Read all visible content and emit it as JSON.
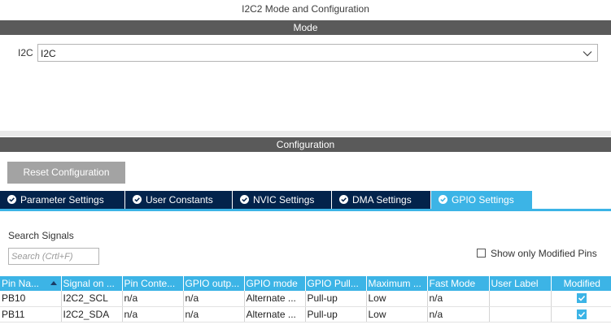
{
  "title": "I2C2 Mode and Configuration",
  "mode_section": {
    "header": "Mode",
    "field_label": "I2C",
    "selected_value": "I2C"
  },
  "config_section": {
    "header": "Configuration",
    "reset_button": "Reset Configuration",
    "tabs": [
      {
        "label": "Parameter Settings",
        "active": false
      },
      {
        "label": "User Constants",
        "active": false
      },
      {
        "label": "NVIC Settings",
        "active": false
      },
      {
        "label": "DMA Settings",
        "active": false
      },
      {
        "label": "GPIO Settings",
        "active": true
      }
    ],
    "search": {
      "label": "Search Signals",
      "placeholder": "Search (Crtl+F)"
    },
    "show_modified_label": "Show only Modified Pins",
    "show_modified_checked": false,
    "table": {
      "columns": [
        "Pin Na...",
        "Signal on ...",
        "Pin Conte...",
        "GPIO outp...",
        "GPIO mode",
        "GPIO Pull...",
        "Maximum ...",
        "Fast Mode",
        "User Label",
        "Modified"
      ],
      "rows": [
        {
          "pin": "PB10",
          "signal": "I2C2_SCL",
          "context": "n/a",
          "output": "n/a",
          "mode": "Alternate ...",
          "pull": "Pull-up",
          "max_speed": "Low",
          "fast_mode": "n/a",
          "user_label": "",
          "modified": true
        },
        {
          "pin": "PB11",
          "signal": "I2C2_SDA",
          "context": "n/a",
          "output": "n/a",
          "mode": "Alternate ...",
          "pull": "Pull-up",
          "max_speed": "Low",
          "fast_mode": "n/a",
          "user_label": "",
          "modified": true
        }
      ]
    }
  },
  "colors": {
    "section_header": "#5a5a5a",
    "tab_inactive": "#03234b",
    "tab_active": "#3cb4e6",
    "reset_button": "#a3a3a3"
  }
}
